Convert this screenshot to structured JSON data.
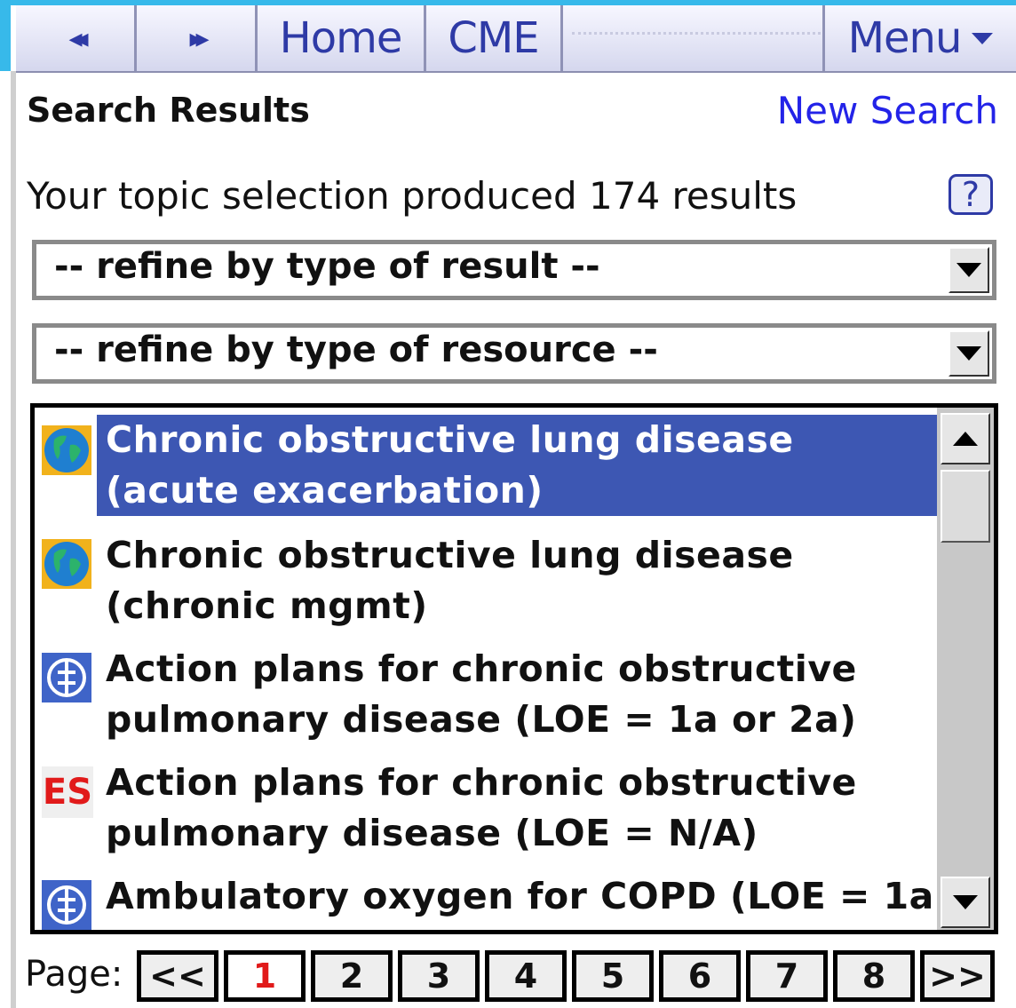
{
  "nav": {
    "back": "◂◂",
    "forward": "▸▸",
    "home": "Home",
    "cme": "CME",
    "menu": "Menu"
  },
  "header": {
    "title": "Search Results",
    "new_search": "New Search"
  },
  "summary": "Your topic selection produced 174 results",
  "help": "?",
  "filters": {
    "result_type": "-- refine by type of result --",
    "resource_type": "-- refine by type of resource --"
  },
  "results": [
    {
      "icon": "globe-icon",
      "line1": "Chronic obstructive lung disease",
      "line2": "(acute exacerbation)",
      "selected": true
    },
    {
      "icon": "globe-icon",
      "line1": "Chronic obstructive lung disease",
      "line2": "(chronic mgmt)",
      "selected": false
    },
    {
      "icon": "evidence-icon",
      "line1": "Action plans for chronic obstructive",
      "line2": "pulmonary disease (LOE = 1a or 2a)",
      "selected": false
    },
    {
      "icon": "es-icon",
      "icon_text": "ES",
      "line1": "Action plans for chronic obstructive",
      "line2": "pulmonary disease (LOE = N/A)",
      "selected": false
    },
    {
      "icon": "evidence-icon",
      "line1": "Ambulatory oxygen for COPD (LOE = 1a",
      "line2": "",
      "selected": false
    }
  ],
  "pagination": {
    "label": "Page:",
    "pages": [
      "<<",
      "1",
      "2",
      "3",
      "4",
      "5",
      "6",
      "7",
      "8",
      ">>"
    ],
    "current": "1"
  },
  "colors": {
    "accent": "#2e3aa6",
    "selection": "#3d57b3",
    "link": "#2323e8",
    "current_page": "#e11a1a",
    "frame": "#37b9ea"
  }
}
